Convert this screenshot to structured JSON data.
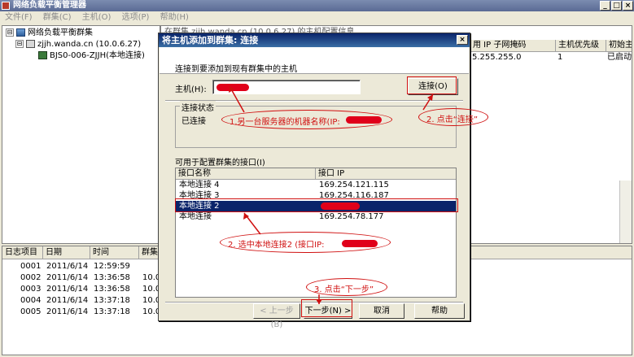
{
  "window": {
    "title": "网络负载平衡管理器",
    "buttons": {
      "minimize": "_",
      "maximize": "□",
      "close": "×"
    }
  },
  "menu": [
    "文件(F)",
    "群集(C)",
    "主机(O)",
    "选项(P)",
    "帮助(H)"
  ],
  "tree": {
    "root": "网络负载平衡群集",
    "cluster": "zjjh.wanda.cn (10.0.6.27)",
    "host": "BJS0-006-ZJJH(本地连接)",
    "expander_root": "⊟",
    "expander_cluster": "⊟"
  },
  "right_pane": {
    "header_text": "在群集 zjjh.wanda.cn (10.0.6.27) 的主机配置信息",
    "columns": [
      "用 IP 子网掩码",
      "主机优先级",
      "初始主"
    ],
    "row": [
      "5.255.255.0",
      "1",
      "已启动"
    ]
  },
  "log": {
    "columns": [
      "日志项目",
      "日期",
      "时间",
      "群集"
    ],
    "rows": [
      [
        "0001",
        "2011/6/14",
        "12:59:59",
        ""
      ],
      [
        "0002",
        "2011/6/14",
        "13:36:58",
        "10.0"
      ],
      [
        "0003",
        "2011/6/14",
        "13:36:58",
        "10.0"
      ],
      [
        "0004",
        "2011/6/14",
        "13:37:18",
        "10.0"
      ],
      [
        "0005",
        "2011/6/14",
        "13:37:18",
        "10.0"
      ]
    ]
  },
  "dialog": {
    "title": "将主机添加到群集:  连接",
    "close": "×",
    "instruction": "连接到要添加到现有群集中的主机",
    "host_label": "主机(H):",
    "connect_button": "连接(O)",
    "status_group": "连接状态",
    "status_value": "已连接",
    "interfaces_label": "可用于配置群集的接口(I)",
    "interface_columns": [
      "接口名称",
      "接口 IP"
    ],
    "interfaces": [
      {
        "name": "本地连接 4",
        "ip": "169.254.121.115"
      },
      {
        "name": "本地连接 3",
        "ip": "169.254.116.187"
      },
      {
        "name": "本地连接 2",
        "ip": ""
      },
      {
        "name": "本地连接",
        "ip": "169.254.78.177"
      }
    ],
    "selected_index": 2,
    "buttons": {
      "back": "< 上一步(B)",
      "next": "下一步(N) >",
      "cancel": "取消",
      "help": "帮助"
    }
  },
  "annotations": {
    "step1": "1.另一台服务器的机器名称(IP:",
    "step2": "2. 点击“连接”",
    "step3": "2. 选中本地连接2 (接口IP:",
    "step4": "3. 点击“下一步”"
  },
  "colors": {
    "annotation": "#d01010",
    "selection": "#0a246a",
    "redaction": "#e0001a"
  }
}
